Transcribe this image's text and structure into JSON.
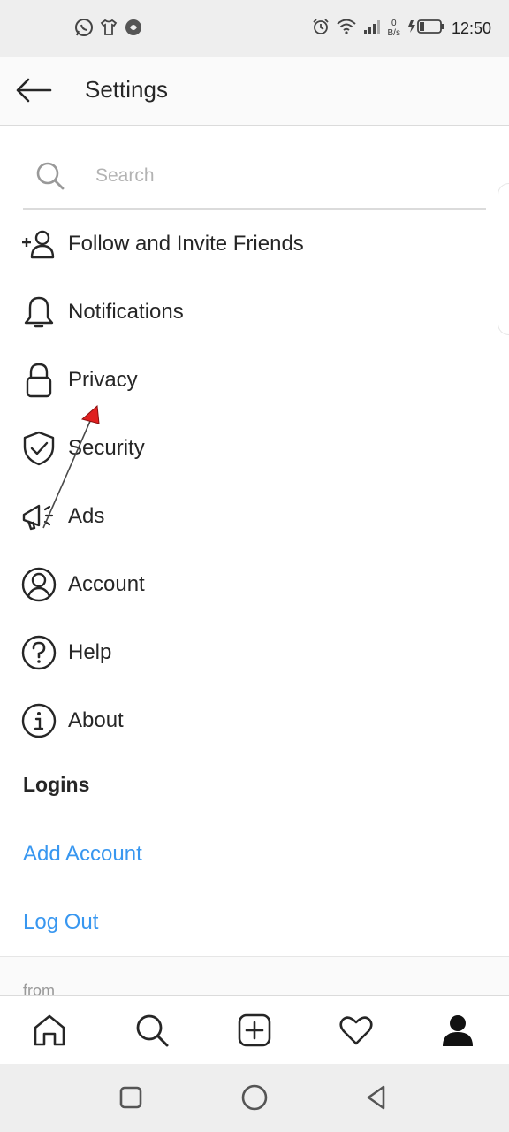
{
  "status_bar": {
    "time": "12:50",
    "net_speed_value": "0",
    "net_speed_unit": "B/s"
  },
  "header": {
    "title": "Settings"
  },
  "search": {
    "placeholder": "Search"
  },
  "menu": {
    "items": [
      {
        "label": "Follow and Invite Friends",
        "icon": "add-person-icon"
      },
      {
        "label": "Notifications",
        "icon": "bell-icon"
      },
      {
        "label": "Privacy",
        "icon": "lock-icon"
      },
      {
        "label": "Security",
        "icon": "shield-check-icon"
      },
      {
        "label": "Ads",
        "icon": "megaphone-icon"
      },
      {
        "label": "Account",
        "icon": "account-circle-icon"
      },
      {
        "label": "Help",
        "icon": "help-icon"
      },
      {
        "label": "About",
        "icon": "info-icon"
      }
    ]
  },
  "logins": {
    "header": "Logins",
    "add_account": "Add Account",
    "log_out": "Log Out"
  },
  "footer": {
    "from": "from"
  },
  "colors": {
    "link": "#3897f0",
    "text": "#262626",
    "annotation_arrow": "#e02020"
  }
}
